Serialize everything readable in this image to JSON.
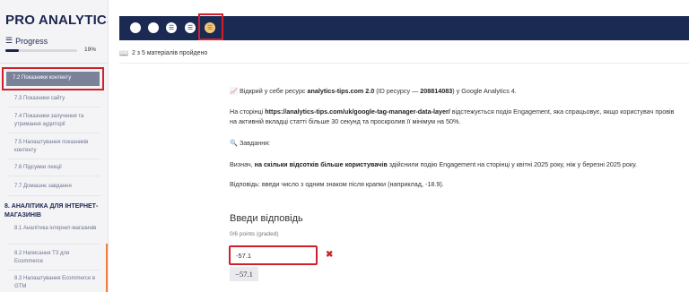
{
  "sidebar": {
    "brand": "PRO ANALYTICS",
    "progress_label": "Progress",
    "progress_percent_text": "19%",
    "progress_fraction": 0.19,
    "active_item": "7.2 Показники контенту",
    "items_before": [
      "7.3 Показники сайту",
      "7.4 Показники залучення та утримання аудиторії",
      "7.5 Налаштування показників контенту",
      "7.6 Підсумки лекції",
      "7.7 Домашнє завдання"
    ],
    "section_title": "8. АНАЛІТИКА ДЛЯ ІНТЕРНЕТ-МАГАЗИНІВ",
    "items_after": [
      "8.1 Аналітика інтернет-магазинів",
      "8.2 Написання ТЗ для Ecommerce",
      "8.3 Налаштування Ecommerce в GTM"
    ]
  },
  "toolbar": {
    "buttons": [
      {
        "icon": "circle-icon"
      },
      {
        "icon": "circle-icon"
      },
      {
        "icon": "list-check-icon"
      },
      {
        "icon": "list-check-icon"
      },
      {
        "icon": "quiz-current-icon"
      }
    ]
  },
  "status": {
    "icon": "book-icon",
    "text": "2 з 5 матеріалів пройдено"
  },
  "content": {
    "p1_emoji": "📈",
    "p1_a": "Відкрий у себе ресурс ",
    "p1_b": "analytics-tips.com 2.0",
    "p1_c": " (ID ресурсу — ",
    "p1_d": "208814083",
    "p1_e": ") у Google Analytics 4.",
    "p2_a": "На сторінці ",
    "p2_b": "https://analytics-tips.com/uk/google-tag-manager-data-layer/",
    "p2_c": " відстежується подія Engagement, яка спрацьовує, якщо користувач провів на активній вкладці статті більше 30 секунд та проскролив її мінімум на 50%.",
    "p3_emoji": "🔍",
    "p3": "Завдання:",
    "p4_a": "Визнач, ",
    "p4_b": "на скільки відсотків більше користувачів",
    "p4_c": " здійснили подію Engagement на сторінці у квітні 2025 року, ніж у березні 2025 року.",
    "p5": "Відповідь: введи число з одним знаком після крапки (наприклад, -18.9)."
  },
  "question": {
    "title": "Введи відповідь",
    "points": "0/6 points (graded)",
    "answer_value": "-57.1",
    "preview": "−57.1",
    "status_icon": "wrong-x-icon"
  },
  "colors": {
    "navy": "#1b2a52",
    "highlight_outline": "#d0202a",
    "active_item_bg": "#7a829a",
    "accent_orange": "#f0803a",
    "status_book": "#e6a028"
  }
}
